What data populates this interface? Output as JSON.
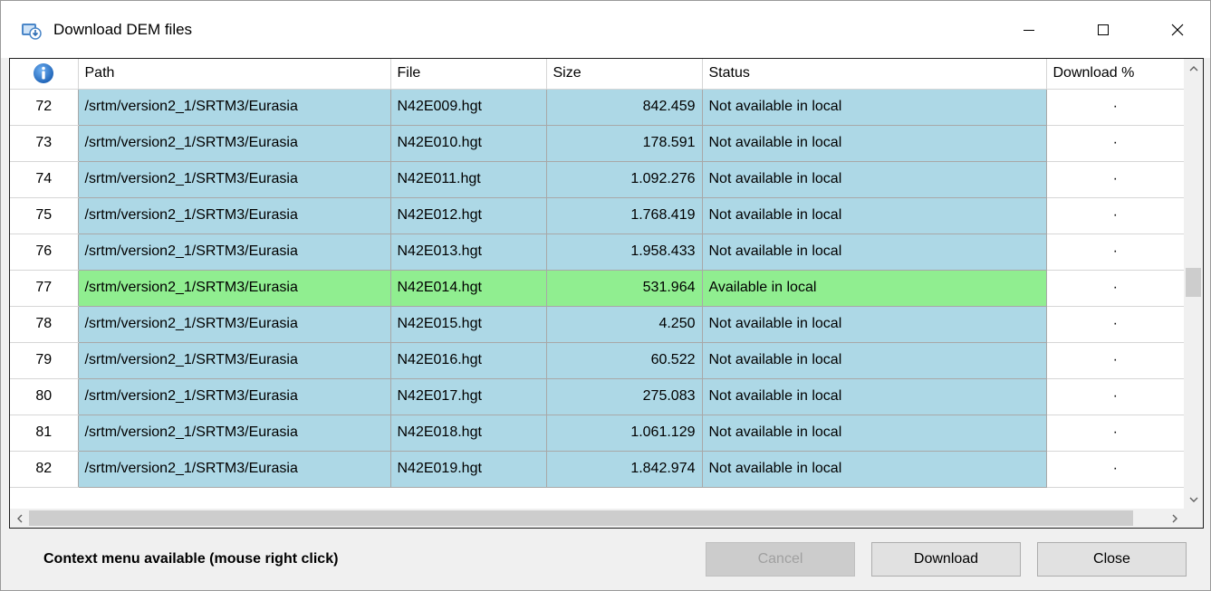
{
  "window": {
    "title": "Download DEM files"
  },
  "grid": {
    "columns": [
      "Path",
      "File",
      "Size",
      "Status",
      "Download %"
    ],
    "rows": [
      {
        "index": "72",
        "path": "/srtm/version2_1/SRTM3/Eurasia",
        "file": "N42E009.hgt",
        "size": "842.459",
        "status": "Not available in local",
        "pct": "·",
        "state": "unavail"
      },
      {
        "index": "73",
        "path": "/srtm/version2_1/SRTM3/Eurasia",
        "file": "N42E010.hgt",
        "size": "178.591",
        "status": "Not available in local",
        "pct": "·",
        "state": "unavail"
      },
      {
        "index": "74",
        "path": "/srtm/version2_1/SRTM3/Eurasia",
        "file": "N42E011.hgt",
        "size": "1.092.276",
        "status": "Not available in local",
        "pct": "·",
        "state": "unavail"
      },
      {
        "index": "75",
        "path": "/srtm/version2_1/SRTM3/Eurasia",
        "file": "N42E012.hgt",
        "size": "1.768.419",
        "status": "Not available in local",
        "pct": "·",
        "state": "unavail"
      },
      {
        "index": "76",
        "path": "/srtm/version2_1/SRTM3/Eurasia",
        "file": "N42E013.hgt",
        "size": "1.958.433",
        "status": "Not available in local",
        "pct": "·",
        "state": "unavail"
      },
      {
        "index": "77",
        "path": "/srtm/version2_1/SRTM3/Eurasia",
        "file": "N42E014.hgt",
        "size": "531.964",
        "status": "Available in local",
        "pct": "·",
        "state": "avail"
      },
      {
        "index": "78",
        "path": "/srtm/version2_1/SRTM3/Eurasia",
        "file": "N42E015.hgt",
        "size": "4.250",
        "status": "Not available in local",
        "pct": "·",
        "state": "unavail"
      },
      {
        "index": "79",
        "path": "/srtm/version2_1/SRTM3/Eurasia",
        "file": "N42E016.hgt",
        "size": "60.522",
        "status": "Not available in local",
        "pct": "·",
        "state": "unavail"
      },
      {
        "index": "80",
        "path": "/srtm/version2_1/SRTM3/Eurasia",
        "file": "N42E017.hgt",
        "size": "275.083",
        "status": "Not available in local",
        "pct": "·",
        "state": "unavail"
      },
      {
        "index": "81",
        "path": "/srtm/version2_1/SRTM3/Eurasia",
        "file": "N42E018.hgt",
        "size": "1.061.129",
        "status": "Not available in local",
        "pct": "·",
        "state": "unavail"
      },
      {
        "index": "82",
        "path": "/srtm/version2_1/SRTM3/Eurasia",
        "file": "N42E019.hgt",
        "size": "1.842.974",
        "status": "Not available in local",
        "pct": "·",
        "state": "unavail"
      }
    ]
  },
  "footer": {
    "hint": "Context menu available (mouse right click)",
    "cancel_label": "Cancel",
    "download_label": "Download",
    "close_label": "Close"
  },
  "colors": {
    "unavailable_row": "#add8e6",
    "available_row": "#90ee90"
  },
  "icons": {
    "app": "download-dem-app-icon",
    "info": "info-icon"
  }
}
